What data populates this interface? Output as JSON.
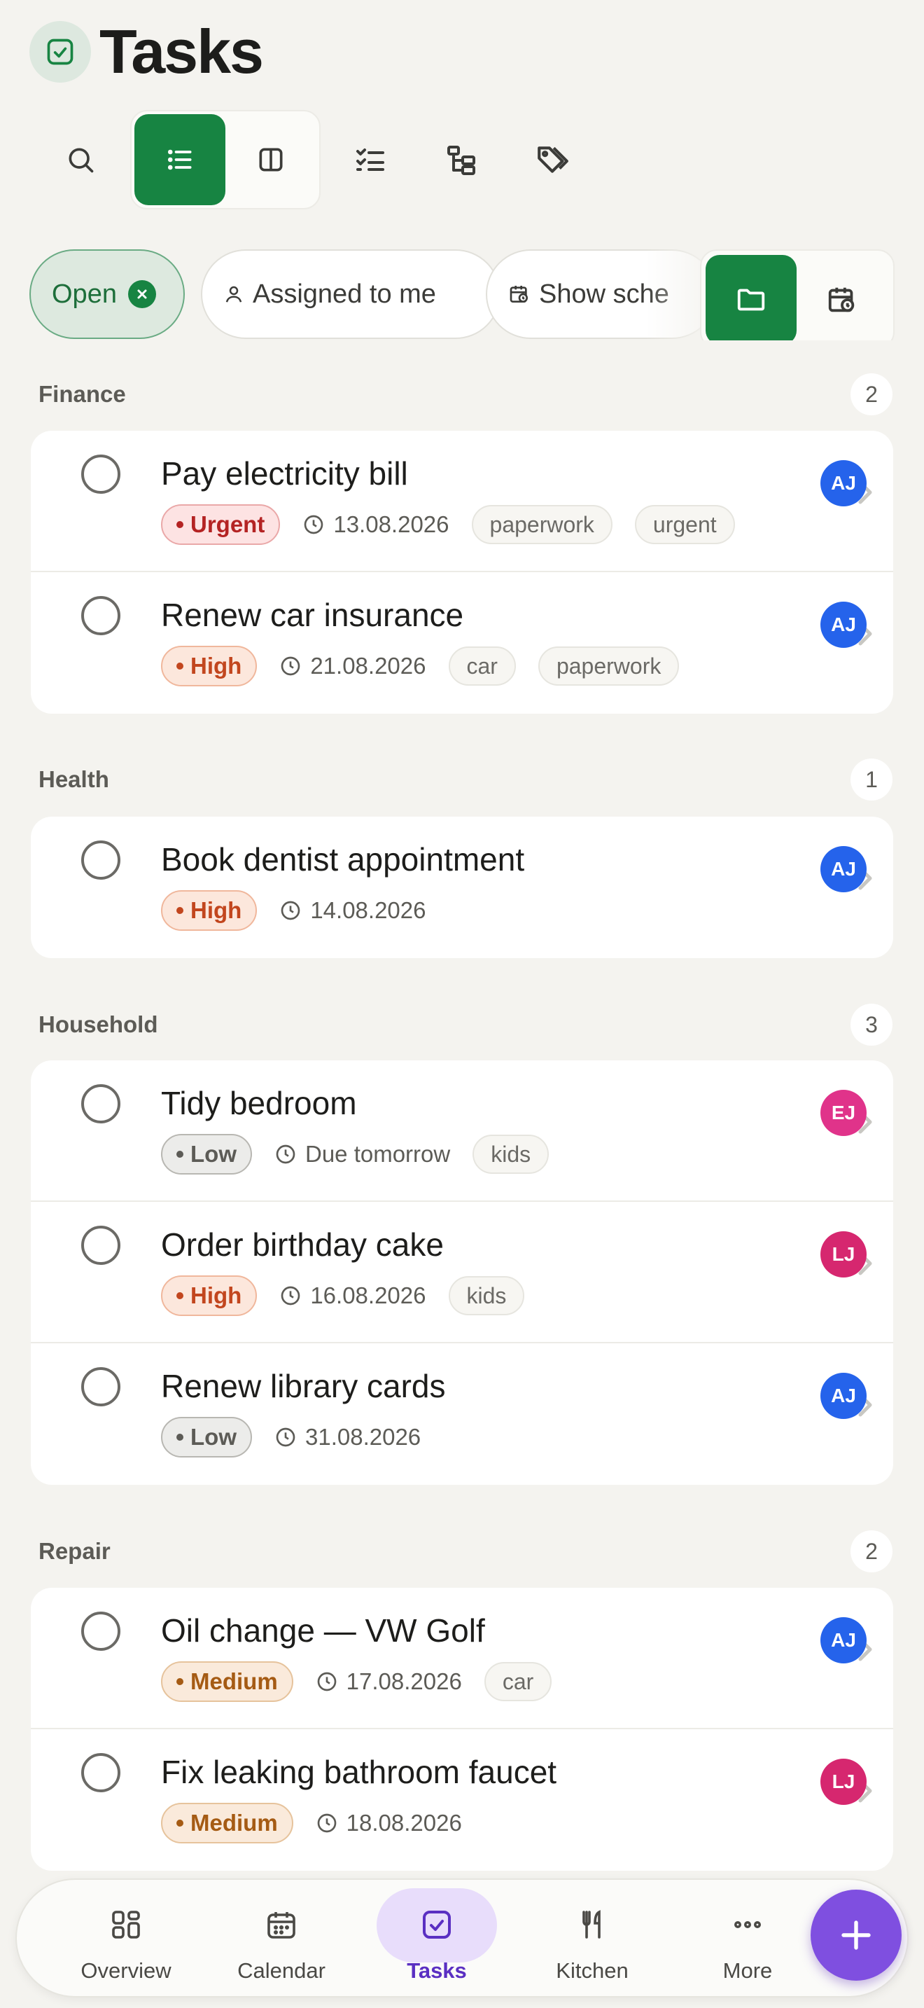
{
  "header": {
    "title": "Tasks",
    "icon": "checkbox-icon"
  },
  "toolbar": {
    "search_icon": "search-icon",
    "views": [
      "list-view-icon",
      "board-view-icon"
    ],
    "extra": [
      "checklist-icon",
      "subtasks-icon",
      "tags-icon"
    ]
  },
  "filters": {
    "open": "Open",
    "assigned": "Assigned to me",
    "scheduled": "Show sche"
  },
  "colors": {
    "accent": "#178442",
    "fab": "#7f4fe0"
  },
  "sections": [
    {
      "title": "Finance",
      "count": "2",
      "tasks": [
        {
          "title": "Pay electricity bill",
          "priority": "Urgent",
          "level": "urgent",
          "due": "13.08.2026",
          "tags": [
            "paperwork",
            "urgent"
          ],
          "avatar": "AJ",
          "avatar_color": "#2563eb"
        },
        {
          "title": "Renew car insurance",
          "priority": "High",
          "level": "high",
          "due": "21.08.2026",
          "tags": [
            "car",
            "paperwork"
          ],
          "avatar": "AJ",
          "avatar_color": "#2563eb"
        }
      ]
    },
    {
      "title": "Health",
      "count": "1",
      "tasks": [
        {
          "title": "Book dentist appointment",
          "priority": "High",
          "level": "high",
          "due": "14.08.2026",
          "tags": [],
          "avatar": "AJ",
          "avatar_color": "#2563eb"
        }
      ]
    },
    {
      "title": "Household",
      "count": "3",
      "tasks": [
        {
          "title": "Tidy bedroom",
          "priority": "Low",
          "level": "low",
          "due": "Due tomorrow",
          "tags": [
            "kids"
          ],
          "avatar": "EJ",
          "avatar_color": "#e0338a"
        },
        {
          "title": "Order birthday cake",
          "priority": "High",
          "level": "high",
          "due": "16.08.2026",
          "tags": [
            "kids"
          ],
          "avatar": "LJ",
          "avatar_color": "#d6276f"
        },
        {
          "title": "Renew library cards",
          "priority": "Low",
          "level": "low",
          "due": "31.08.2026",
          "tags": [],
          "avatar": "AJ",
          "avatar_color": "#2563eb"
        }
      ]
    },
    {
      "title": "Repair",
      "count": "2",
      "tasks": [
        {
          "title": "Oil change — VW Golf",
          "priority": "Medium",
          "level": "medium",
          "due": "17.08.2026",
          "tags": [
            "car"
          ],
          "avatar": "AJ",
          "avatar_color": "#2563eb"
        },
        {
          "title": "Fix leaking bathroom faucet",
          "priority": "Medium",
          "level": "medium",
          "due": "18.08.2026",
          "tags": [],
          "avatar": "LJ",
          "avatar_color": "#d6276f"
        }
      ]
    }
  ],
  "nav": [
    {
      "label": "Overview",
      "icon": "overview-icon"
    },
    {
      "label": "Calendar",
      "icon": "calendar-icon"
    },
    {
      "label": "Tasks",
      "icon": "tasks-icon",
      "active": true
    },
    {
      "label": "Kitchen",
      "icon": "kitchen-icon"
    },
    {
      "label": "More",
      "icon": "more-icon"
    }
  ],
  "fab_icon": "plus-icon"
}
